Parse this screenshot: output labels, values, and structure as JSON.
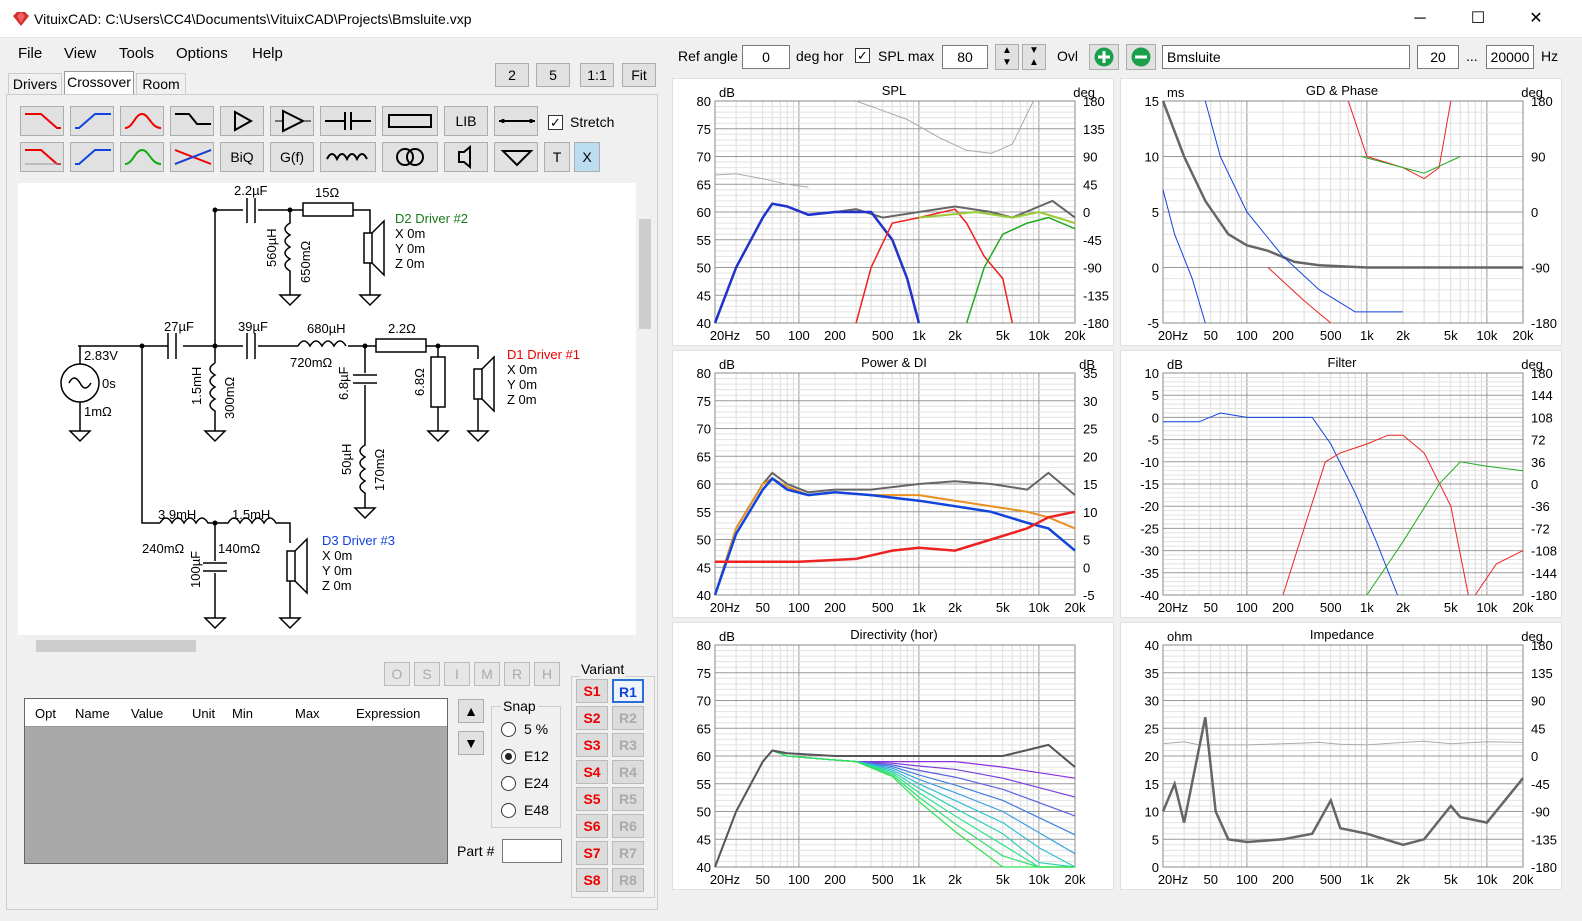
{
  "window": {
    "title": "VituixCAD: C:\\Users\\CC4\\Documents\\VituixCAD\\Projects\\Bmsluite.vxp",
    "minimize": "─",
    "maximize": "☐",
    "close": "✕"
  },
  "menu": [
    "File",
    "View",
    "Tools",
    "Options",
    "Help"
  ],
  "zoom": {
    "b2": "2",
    "b5": "5",
    "b11": "1:1",
    "fit": "Fit"
  },
  "tabs": [
    "Drivers",
    "Crossover",
    "Room"
  ],
  "toolbar": {
    "lib": "LIB",
    "biq": "BiQ",
    "gf": "G(f)",
    "t": "T",
    "x": "X",
    "stretch": "Stretch"
  },
  "top": {
    "ref_angle_label": "Ref angle",
    "ref_angle": "0",
    "deg_hor": "deg hor",
    "spl_max_label": "SPL max",
    "spl_max": "80",
    "ovl": "Ovl",
    "name": "Bmsluite",
    "f_min": "20",
    "dots": "...",
    "f_max": "20000",
    "hz": "Hz"
  },
  "schematic": {
    "d2_name": "D2 Driver #2",
    "d1_name": "D1 Driver #1",
    "d3_name": "D3 Driver #3",
    "xyz": [
      "X 0m",
      "Y 0m",
      "Z 0m"
    ],
    "source_v": "2.83V",
    "source_t": "0s",
    "source_r": "1mΩ",
    "c22": "2.2µF",
    "r15": "15Ω",
    "l560": "560µH",
    "r650": "650mΩ",
    "c27": "27µF",
    "c39": "39µF",
    "l680": "680µH",
    "r720": "720mΩ",
    "r22": "2.2Ω",
    "l15": "1.5mH",
    "r300": "300mΩ",
    "c68": "6.8µF",
    "r68": "6.8Ω",
    "l50": "50µH",
    "r170": "170mΩ",
    "l39": "3.9mH",
    "r240": "240mΩ",
    "l15b": "1.5mH",
    "r140": "140mΩ",
    "c100": "100µF"
  },
  "mode_btns": [
    "O",
    "S",
    "I",
    "M",
    "R",
    "H"
  ],
  "table": {
    "headers": [
      "Opt",
      "Name",
      "Value",
      "Unit",
      "Min",
      "Max",
      "Expression"
    ]
  },
  "snap": {
    "title": "Snap",
    "options": [
      "5 %",
      "E12",
      "E24",
      "E48"
    ],
    "selected": 1
  },
  "part_label": "Part #",
  "variant": {
    "title": "Variant",
    "s": [
      "S1",
      "S2",
      "S3",
      "S4",
      "S5",
      "S6",
      "S7",
      "S8"
    ],
    "r": [
      "R1",
      "R2",
      "R3",
      "R4",
      "R5",
      "R6",
      "R7",
      "R8"
    ]
  },
  "charts": {
    "spl": {
      "title": "SPL",
      "yl": "dB",
      "yr": "deg",
      "yticks": [
        "80",
        "75",
        "70",
        "65",
        "60",
        "55",
        "50",
        "45",
        "40"
      ],
      "rticks": [
        "180",
        "135",
        "90",
        "45",
        "0",
        "-45",
        "-90",
        "-135",
        "-180"
      ]
    },
    "gd": {
      "title": "GD & Phase",
      "yl": "ms",
      "yr": "deg",
      "yticks": [
        "15",
        "10",
        "5",
        "0",
        "-5"
      ],
      "rticks": [
        "180",
        "90",
        "0",
        "-90",
        "-180"
      ]
    },
    "power": {
      "title": "Power & DI",
      "yl": "dB",
      "yr": "dB",
      "yticks": [
        "80",
        "75",
        "70",
        "65",
        "60",
        "55",
        "50",
        "45",
        "40"
      ],
      "rticks": [
        "35",
        "30",
        "25",
        "20",
        "15",
        "10",
        "5",
        "0",
        "-5"
      ]
    },
    "filter": {
      "title": "Filter",
      "yl": "dB",
      "yr": "deg",
      "yticks": [
        "10",
        "5",
        "0",
        "-5",
        "-10",
        "-15",
        "-20",
        "-25",
        "-30",
        "-35",
        "-40"
      ],
      "rticks": [
        "180",
        "144",
        "108",
        "72",
        "36",
        "0",
        "-36",
        "-72",
        "-108",
        "-144",
        "-180"
      ]
    },
    "dir": {
      "title": "Directivity (hor)",
      "yl": "dB",
      "yr": "",
      "yticks": [
        "80",
        "75",
        "70",
        "65",
        "60",
        "55",
        "50",
        "45",
        "40"
      ],
      "rticks": []
    },
    "imp": {
      "title": "Impedance",
      "yl": "ohm",
      "yr": "deg",
      "yticks": [
        "40",
        "35",
        "30",
        "25",
        "20",
        "15",
        "10",
        "5",
        "0"
      ],
      "rticks": [
        "180",
        "135",
        "90",
        "45",
        "0",
        "-45",
        "-90",
        "-135",
        "-180"
      ]
    },
    "xticks": [
      "20Hz",
      "50",
      "100",
      "200",
      "500",
      "1k",
      "2k",
      "5k",
      "10k",
      "20k"
    ]
  }
}
